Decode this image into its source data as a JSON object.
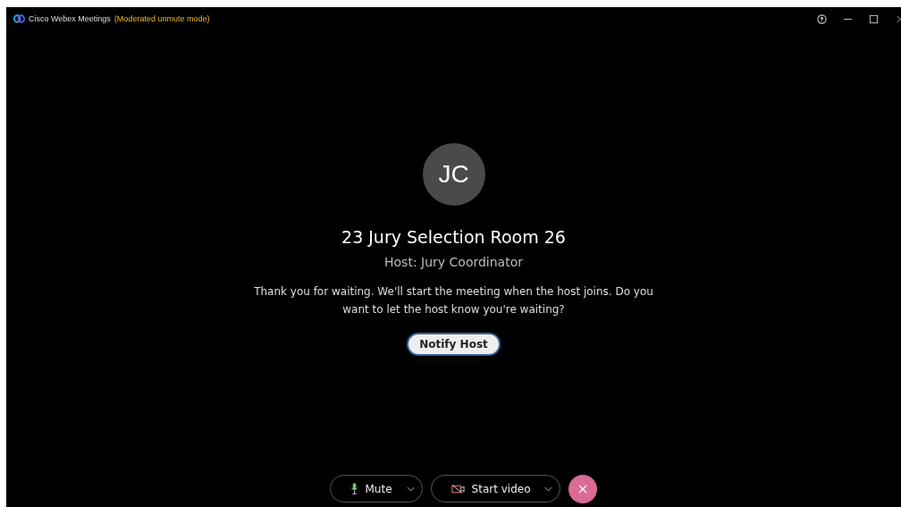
{
  "window": {
    "title": "Cisco Webex Meetings",
    "mode": "(Moderated unmute mode)"
  },
  "avatar": {
    "initials": "JC"
  },
  "meeting": {
    "title": "23 Jury Selection Room 26",
    "host": "Host: Jury Coordinator",
    "message": "Thank you for waiting. We'll start the meeting when the host joins. Do you want to let the host know you're waiting?"
  },
  "notify_button": {
    "label": "Notify Host"
  },
  "controls": [
    {
      "kind": "mute",
      "label": "Mute"
    },
    {
      "kind": "video",
      "label": "Start video"
    },
    {
      "kind": "leave"
    }
  ]
}
